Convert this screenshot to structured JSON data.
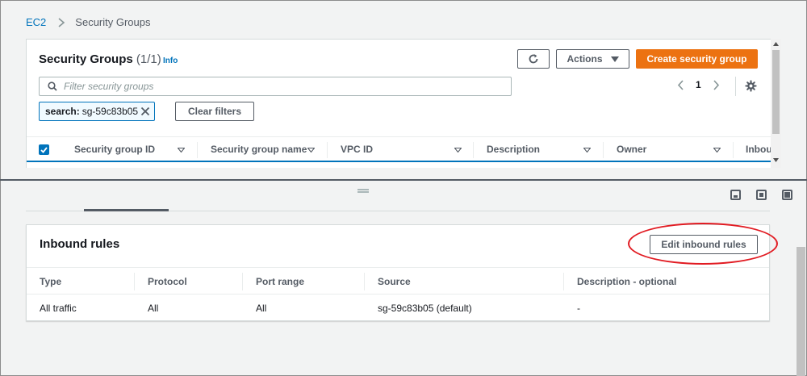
{
  "breadcrumb": {
    "root": "EC2",
    "current": "Security Groups"
  },
  "security_groups": {
    "title": "Security Groups",
    "count": "(1/1)",
    "info": "Info",
    "actions_label": "Actions",
    "create_label": "Create security group",
    "filter_placeholder": "Filter security groups",
    "page": "1",
    "token": {
      "key": "search:",
      "value": "sg-59c83b05"
    },
    "clear_filters": "Clear filters",
    "columns": [
      "Security group ID",
      "Security group name",
      "VPC ID",
      "Description",
      "Owner",
      "Inbou"
    ]
  },
  "inbound_rules": {
    "title": "Inbound rules",
    "edit_label": "Edit inbound rules",
    "columns": [
      "Type",
      "Protocol",
      "Port range",
      "Source",
      "Description - optional"
    ],
    "rows": [
      {
        "type": "All traffic",
        "protocol": "All",
        "port_range": "All",
        "source": "sg-59c83b05 (default)",
        "description": "-"
      }
    ]
  },
  "colors": {
    "accent": "#ec7211",
    "link": "#0073bb",
    "highlight": "#e11b22"
  },
  "icons": [
    "chevron-right-icon",
    "refresh-icon",
    "caret-down-icon",
    "search-icon",
    "chevron-left-icon",
    "gear-icon",
    "close-icon",
    "sort-icon",
    "drag-handle-icon",
    "panel-bottom-icon",
    "panel-side-icon",
    "panel-full-icon"
  ]
}
